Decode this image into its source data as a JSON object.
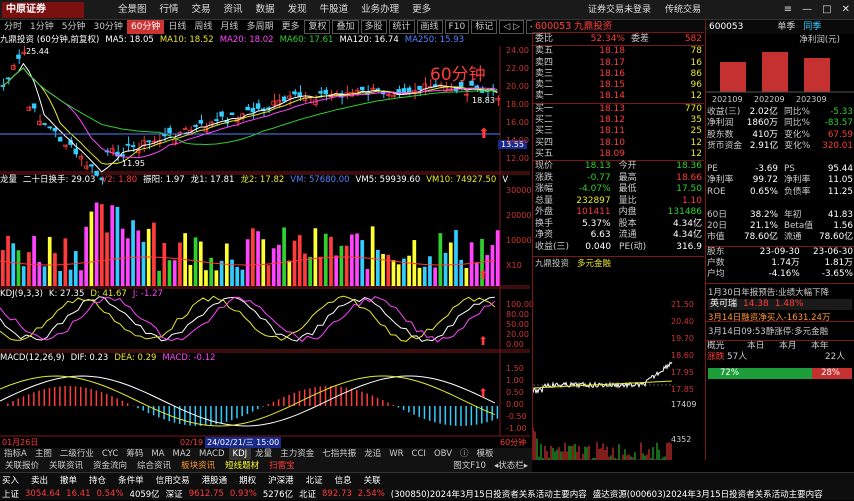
{
  "menubar": {
    "logo": "中原证券",
    "items": [
      "全景图",
      "行情",
      "交易",
      "资讯",
      "数据",
      "发现",
      "牛股道",
      "业务办理",
      "更多"
    ],
    "right": [
      "证券交易未登录",
      "传统交易"
    ],
    "win": [
      "≡",
      "—",
      "□",
      "✕"
    ]
  },
  "ptabs": [
    "分时",
    "1分钟",
    "5分钟",
    "30分钟",
    "60分钟",
    "日线",
    "周线",
    "月线",
    "多周期",
    "更多",
    "复权",
    "叠加",
    "多股",
    "统计",
    "画线",
    "F10",
    "标记",
    "◁ ▷",
    "◁ ▷"
  ],
  "main": {
    "ind1": [
      {
        "t": "九鼎投资 (60分钟,前复权)",
        "c": "white"
      },
      {
        "t": "MA5: 18.05",
        "c": "white"
      },
      {
        "t": "MA10: 18.52",
        "c": "yellow"
      },
      {
        "t": "MA20: 18.02",
        "c": "mag"
      },
      {
        "t": "MA60: 17.61",
        "c": "green"
      },
      {
        "t": "MA120: 16.74",
        "c": "white"
      },
      {
        "t": "MA250: 15.93",
        "c": "blue"
      }
    ],
    "period_label": "60分钟",
    "high_label": "25.44",
    "low_label": "11.95",
    "last_label": "18.83",
    "cur_price": "13.55",
    "axis1": [
      "24.00",
      "22.00",
      "20.00",
      "18.00",
      "16.00",
      "14.00",
      "12.00"
    ],
    "ind2": [
      {
        "t": "龙量",
        "c": "white"
      },
      {
        "t": "二十日换手: 29.03",
        "c": "white"
      },
      {
        "t": "V2: 1.80",
        "c": "red"
      },
      {
        "t": "振阳: 1.97",
        "c": "white"
      },
      {
        "t": "龙1: 17.81",
        "c": "white"
      },
      {
        "t": "龙2: 17.82",
        "c": "yellow"
      },
      {
        "t": "VM: 57680.00",
        "c": "blue"
      },
      {
        "t": "VM5: 59939.60",
        "c": "white"
      },
      {
        "t": "VM10: 74927.50",
        "c": "yellow"
      },
      {
        "t": "V",
        "c": "white"
      }
    ],
    "axis2": [
      "30000",
      "20000",
      "10000",
      "X10"
    ],
    "ind3": [
      {
        "t": "KDJ(9,3,3)",
        "c": "white"
      },
      {
        "t": "K: 27.35",
        "c": "white"
      },
      {
        "t": "D: 41.67",
        "c": "yellow"
      },
      {
        "t": "J: -1.27",
        "c": "mag"
      }
    ],
    "axis3": [
      "100.00",
      "80.00",
      "50.00",
      "20.00",
      "0.00"
    ],
    "ind4": [
      {
        "t": "MACD(12,26,9)",
        "c": "white"
      },
      {
        "t": "DIF: 0.23",
        "c": "white"
      },
      {
        "t": "DEA: 0.29",
        "c": "yellow"
      },
      {
        "t": "MACD: -0.12",
        "c": "mag"
      }
    ],
    "axis4": [
      "1.50",
      "1.00",
      "0.50",
      "0.00",
      "-0.50",
      "-1.00"
    ],
    "date_axis": [
      "01月26日",
      "02/19",
      "24/02/21/三 15:00",
      "60分钟"
    ],
    "bottom_tabs1": [
      "指标A",
      "主图",
      "二级行业",
      "CYC",
      "筹码",
      "MA",
      "MA2",
      "MACD",
      "KDJ",
      "龙量",
      "主力资金",
      "七指共振",
      "龙追",
      "WR",
      "CCI",
      "OBV",
      "ⓘ",
      "模板"
    ],
    "bottom_tabs1_act": "KDJ",
    "bottom_tabs2": [
      "关联报价",
      "关联资讯",
      "资金流向",
      "综合资讯",
      "板块资讯",
      "短线题材",
      "扫雷宝"
    ],
    "bottom_tabs2_right": [
      "图文F10",
      "◂状态栏▸"
    ]
  },
  "quote": {
    "code": "600053",
    "name": "九鼎投资",
    "wb_label": "委比",
    "wb_pct": "52.34%",
    "wc_label": "委差",
    "wc_val": "582",
    "asks": [
      {
        "l": "卖五",
        "p": "18.18",
        "v": "78"
      },
      {
        "l": "卖四",
        "p": "18.17",
        "v": "16"
      },
      {
        "l": "卖三",
        "p": "18.16",
        "v": "86"
      },
      {
        "l": "卖二",
        "p": "18.15",
        "v": "96"
      },
      {
        "l": "卖一",
        "p": "18.14",
        "v": "12"
      }
    ],
    "bids": [
      {
        "l": "买一",
        "p": "18.13",
        "v": "770"
      },
      {
        "l": "买二",
        "p": "18.12",
        "v": "35"
      },
      {
        "l": "买三",
        "p": "18.11",
        "v": "25"
      },
      {
        "l": "买四",
        "p": "18.10",
        "v": "12"
      },
      {
        "l": "买五",
        "p": "18.09",
        "v": "12"
      }
    ],
    "stats": [
      [
        {
          "t": "现价",
          "c": ""
        },
        {
          "t": "18.13",
          "c": "green"
        },
        {
          "t": "今开",
          "c": ""
        },
        {
          "t": "18.36",
          "c": "green"
        }
      ],
      [
        {
          "t": "涨跌",
          "c": ""
        },
        {
          "t": "-0.77",
          "c": "green"
        },
        {
          "t": "最高",
          "c": ""
        },
        {
          "t": "18.66",
          "c": "red"
        }
      ],
      [
        {
          "t": "涨幅",
          "c": ""
        },
        {
          "t": "-4.07%",
          "c": "green"
        },
        {
          "t": "最低",
          "c": ""
        },
        {
          "t": "17.50",
          "c": "green"
        }
      ],
      [
        {
          "t": "总量",
          "c": ""
        },
        {
          "t": "232897",
          "c": "yellow"
        },
        {
          "t": "量比",
          "c": ""
        },
        {
          "t": "1.10",
          "c": "red"
        }
      ],
      [
        {
          "t": "外盘",
          "c": ""
        },
        {
          "t": "101411",
          "c": "red"
        },
        {
          "t": "内盘",
          "c": ""
        },
        {
          "t": "131486",
          "c": "green"
        }
      ],
      [
        {
          "t": "换手",
          "c": ""
        },
        {
          "t": "5.37%",
          "c": "white"
        },
        {
          "t": "股本",
          "c": ""
        },
        {
          "t": "4.34亿",
          "c": "white"
        }
      ],
      [
        {
          "t": "净资",
          "c": ""
        },
        {
          "t": "6.63",
          "c": "white"
        },
        {
          "t": "流通",
          "c": ""
        },
        {
          "t": "4.34亿",
          "c": "white"
        }
      ],
      [
        {
          "t": "收益(三)",
          "c": ""
        },
        {
          "t": "0.040",
          "c": "white"
        },
        {
          "t": "PE(动)",
          "c": ""
        },
        {
          "t": "316.9",
          "c": "white"
        }
      ]
    ],
    "mini_tabs": [
      "九鼎投资",
      "多元金融"
    ],
    "mini_axis": [
      "21.50",
      "20.40",
      "19.70",
      "18.60",
      "17.95",
      "17.85",
      "17409",
      "4352"
    ]
  },
  "f10": {
    "code": "600053",
    "tabs": [
      "单季",
      "同季"
    ],
    "chart_title": "净利润(元)",
    "bar_labels": [
      "202109",
      "202209",
      "202309"
    ],
    "rows": [
      [
        {
          "t": "收益(三)",
          "c": ""
        },
        {
          "t": "2.02亿",
          "c": "white"
        },
        {
          "t": "同比%",
          "c": ""
        },
        {
          "t": "-5.33",
          "c": "green"
        }
      ],
      [
        {
          "t": "净利润",
          "c": ""
        },
        {
          "t": "1860万",
          "c": "white"
        },
        {
          "t": "同比%",
          "c": ""
        },
        {
          "t": "-83.57",
          "c": "green"
        }
      ],
      [
        {
          "t": "股东数",
          "c": ""
        },
        {
          "t": "410万",
          "c": "white"
        },
        {
          "t": "变化%",
          "c": ""
        },
        {
          "t": "67.59",
          "c": "red"
        }
      ],
      [
        {
          "t": "货币资金",
          "c": ""
        },
        {
          "t": "2.91亿",
          "c": "white"
        },
        {
          "t": "变化%",
          "c": ""
        },
        {
          "t": "320.01",
          "c": "red"
        }
      ],
      [
        {
          "t": "",
          "c": ""
        },
        {
          "t": "",
          "c": ""
        },
        {
          "t": "",
          "c": ""
        },
        {
          "t": "",
          "c": ""
        }
      ],
      [
        {
          "t": "PE",
          "c": ""
        },
        {
          "t": "-3.69",
          "c": "white"
        },
        {
          "t": "PS",
          "c": ""
        },
        {
          "t": "95.44",
          "c": "white"
        }
      ],
      [
        {
          "t": "净利率",
          "c": ""
        },
        {
          "t": "99.72",
          "c": "white"
        },
        {
          "t": "净利率",
          "c": ""
        },
        {
          "t": "11.05",
          "c": "white"
        }
      ],
      [
        {
          "t": "ROE",
          "c": ""
        },
        {
          "t": "0.65%",
          "c": "white"
        },
        {
          "t": "负债率",
          "c": ""
        },
        {
          "t": "11.25",
          "c": "white"
        }
      ],
      [
        {
          "t": "",
          "c": ""
        },
        {
          "t": "",
          "c": ""
        },
        {
          "t": "",
          "c": ""
        },
        {
          "t": "",
          "c": ""
        }
      ],
      [
        {
          "t": "60日",
          "c": ""
        },
        {
          "t": "38.2%",
          "c": "white"
        },
        {
          "t": "年初",
          "c": ""
        },
        {
          "t": "41.83",
          "c": "white"
        }
      ],
      [
        {
          "t": "20日",
          "c": ""
        },
        {
          "t": "21.1%",
          "c": "white"
        },
        {
          "t": "Beta值",
          "c": ""
        },
        {
          "t": "1.56",
          "c": "white"
        }
      ],
      [
        {
          "t": "市值",
          "c": ""
        },
        {
          "t": "78.60亿",
          "c": "white"
        },
        {
          "t": "流通",
          "c": ""
        },
        {
          "t": "78.60亿",
          "c": "white"
        }
      ]
    ],
    "hold": [
      [
        {
          "t": "股东",
          "c": ""
        },
        {
          "t": "23-09-30",
          "c": "white"
        },
        {
          "t": "23-06-30",
          "c": "white"
        }
      ],
      [
        {
          "t": "户数",
          "c": ""
        },
        {
          "t": "1.74万",
          "c": "white"
        },
        {
          "t": "1.81万",
          "c": "white"
        }
      ],
      [
        {
          "t": "户均",
          "c": ""
        },
        {
          "t": "-4.16%",
          "c": "white"
        },
        {
          "t": "-3.65%",
          "c": "white"
        }
      ]
    ],
    "news1": "1月30日年报预告:业绩大幅下降",
    "popup": {
      "name": "英可瑞",
      "price": "14.38",
      "pct": "1.48%"
    },
    "news2": "3月14日融资净买入-1631.24万",
    "news3": "3月14日09:53静涨停:多元金融",
    "sector": {
      "l": "概光",
      "t1": "本日",
      "t2": "本月",
      "t3": "本年"
    },
    "zt": {
      "l": "涨跌",
      "v1": "57人",
      "v2": "22人"
    },
    "bar": {
      "green": "72%",
      "red": "28%",
      "green_pct": 72
    }
  },
  "bottom": {
    "row1": [
      {
        "t": "买入",
        "c": "white"
      },
      {
        "t": "卖出",
        "c": "white"
      },
      {
        "t": "撤单",
        "c": "white"
      },
      {
        "t": "持仓",
        "c": "white"
      },
      {
        "t": "条件单",
        "c": "white"
      },
      {
        "t": "信用交易",
        "c": "white"
      },
      {
        "t": "港股通",
        "c": "white"
      },
      {
        "t": "期权",
        "c": "white"
      },
      {
        "t": "沪深港",
        "c": "white"
      },
      {
        "t": "北证",
        "c": "white"
      },
      {
        "t": "信息",
        "c": "white"
      },
      {
        "t": "关联",
        "c": "white"
      }
    ],
    "row2": [
      {
        "t": "上证",
        "c": "white"
      },
      {
        "t": "3054.64",
        "c": "red"
      },
      {
        "t": "16.41",
        "c": "red"
      },
      {
        "t": "0.54%",
        "c": "red"
      },
      {
        "t": "4059亿",
        "c": "white"
      },
      {
        "t": "深证",
        "c": "white"
      },
      {
        "t": "9612.75",
        "c": "red"
      },
      {
        "t": "0.93%",
        "c": "red"
      },
      {
        "t": "5276亿",
        "c": "white"
      },
      {
        "t": "北证",
        "c": "white"
      },
      {
        "t": "892.73",
        "c": "red"
      },
      {
        "t": "2.54%",
        "c": "red"
      },
      {
        "t": "(300850)2024年3月15日投资者关系活动主要内容",
        "c": "white"
      },
      {
        "t": "盛达资源(000603)2024年3月15日投资者关系活动主要内容",
        "c": "white"
      }
    ]
  }
}
